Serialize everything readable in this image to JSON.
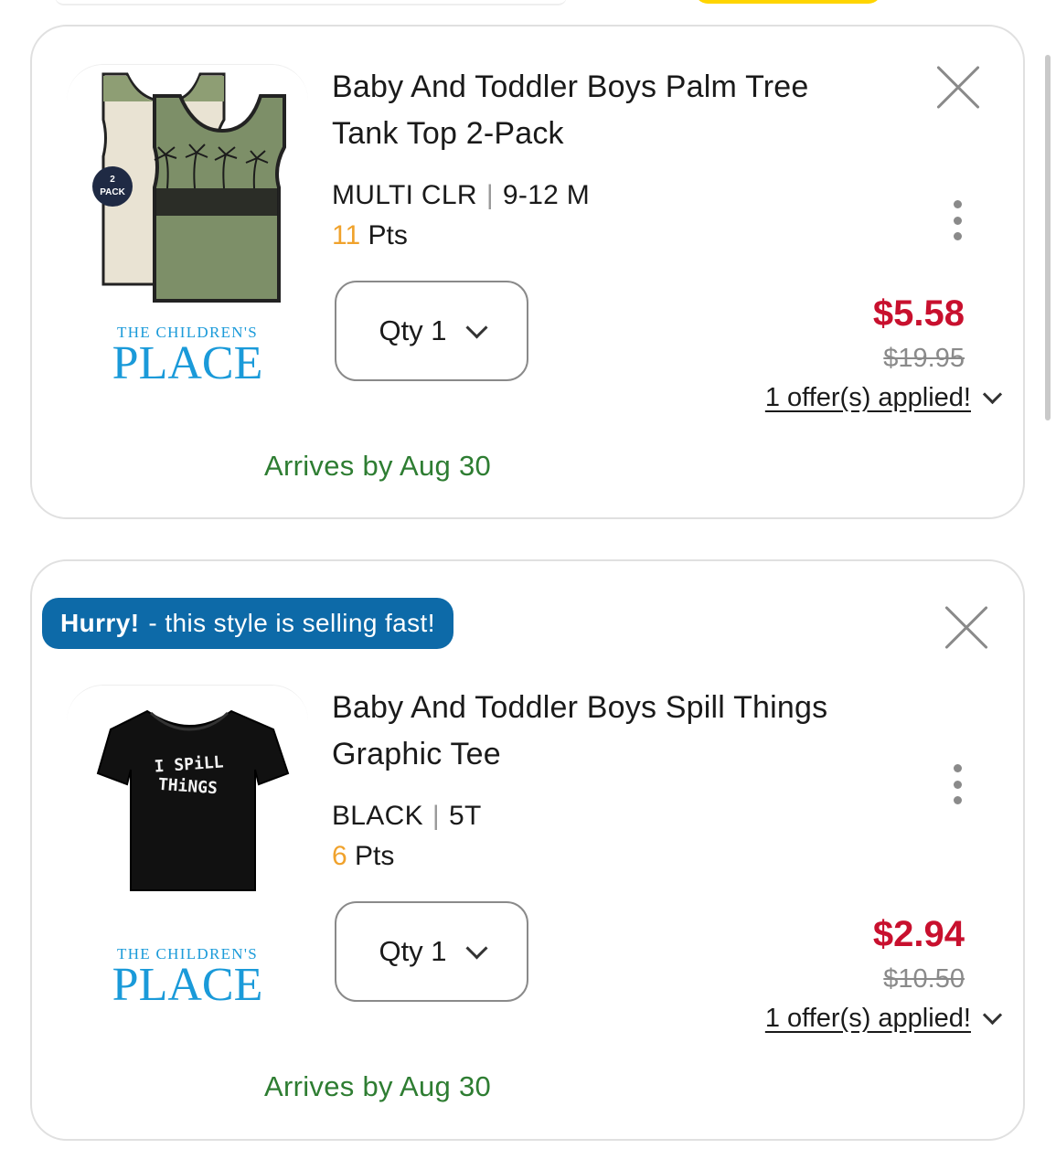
{
  "cart": {
    "items": [
      {
        "title": "Baby And Toddler Boys Palm Tree Tank Top 2-Pack",
        "color": "MULTI CLR",
        "size": "9-12 M",
        "points": "11",
        "points_label": "Pts",
        "qty_label": "Qty 1",
        "price": "$5.58",
        "original_price": "$19.95",
        "offers_label": "1 offer(s) applied!",
        "arrival": "Arrives by Aug 30",
        "badge_text": "2 PACK",
        "brand_small": "THE CHILDREN'S",
        "brand_big": "PLACE",
        "image_icon": "tank-top-2pack-image"
      },
      {
        "title": "Baby And Toddler Boys Spill Things Graphic Tee",
        "color": "BLACK",
        "size": "5T",
        "points": "6",
        "points_label": "Pts",
        "qty_label": "Qty 1",
        "price": "$2.94",
        "original_price": "$10.50",
        "offers_label": "1 offer(s) applied!",
        "arrival": "Arrives by Aug 30",
        "hurry_bold": "Hurry!",
        "hurry_text": "- this style is selling fast!",
        "shirt_text_1": "I SPiLL",
        "shirt_text_2": "THiNGS",
        "brand_small": "THE CHILDREN'S",
        "brand_big": "PLACE",
        "image_icon": "graphic-tee-image"
      }
    ]
  },
  "colors": {
    "sale_price": "#c8102e",
    "points": "#f0a22c",
    "arrival": "#2e7d32",
    "hurry_badge": "#0d6aa8",
    "brand": "#1a9ad9",
    "accent_yellow": "#ffd500"
  }
}
